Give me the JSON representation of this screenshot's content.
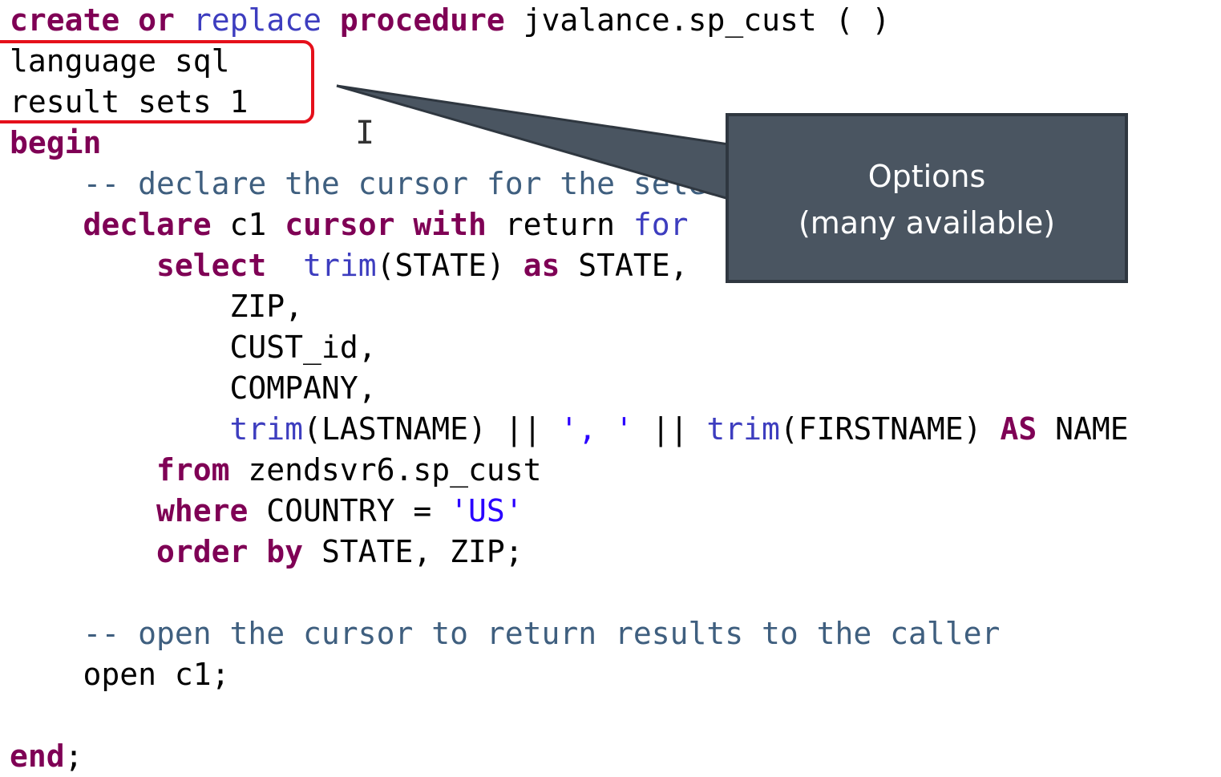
{
  "code": {
    "line1": {
      "kw_create": "create",
      "sp1": " ",
      "kw_or": "or",
      "sp2": " ",
      "fn_replace": "replace",
      "sp3": " ",
      "kw_procedure": "procedure",
      "rest": " jvalance.sp_cust ( )"
    },
    "line2": {
      "text": "language sql"
    },
    "line3": {
      "text": "result sets 1"
    },
    "line4": {
      "kw_begin": "begin"
    },
    "line5": {
      "indent": "    ",
      "comment": "-- declare the cursor for the selec"
    },
    "line6": {
      "indent": "    ",
      "kw_declare": "declare",
      "mid1": " c1 ",
      "kw_cursor": "cursor",
      "sp": " ",
      "kw_with": "with",
      "mid2": " return ",
      "fn_for": "for"
    },
    "line7": {
      "indent": "        ",
      "kw_select": "select",
      "sp": "  ",
      "fn_trim": "trim",
      "mid": "(STATE) ",
      "kw_as": "as",
      "rest": " STATE,"
    },
    "line8": {
      "indent": "            ",
      "text": "ZIP,"
    },
    "line9": {
      "indent": "            ",
      "text": "CUST_id,"
    },
    "line10": {
      "indent": "            ",
      "text": "COMPANY,"
    },
    "line11": {
      "indent": "            ",
      "fn_trim1": "trim",
      "mid1": "(LASTNAME) || ",
      "str": "', '",
      "mid2": " || ",
      "fn_trim2": "trim",
      "mid3": "(FIRSTNAME) ",
      "kw_as": "AS",
      "rest": " NAME"
    },
    "line12": {
      "indent": "        ",
      "kw_from": "from",
      "rest": " zendsvr6.sp_cust"
    },
    "line13": {
      "indent": "        ",
      "kw_where": "where",
      "mid": " COUNTRY = ",
      "str": "'US'"
    },
    "line14": {
      "indent": "        ",
      "kw_order_by": "order by",
      "rest": " STATE, ZIP;"
    },
    "line15": {
      "indent": "    ",
      "comment": "-- open the cursor to return results to the caller"
    },
    "line16": {
      "indent": "    ",
      "text": "open c1;"
    },
    "line17": {
      "kw_end": "end",
      "rest": ";"
    }
  },
  "callout": {
    "line1": "Options",
    "line2": "(many available)"
  },
  "cursor_glyph": "I",
  "colors": {
    "keyword": "#7f0055",
    "function": "#3d3dbf",
    "comment": "#3f5f7f",
    "string": "#2a00ff",
    "highlight_border": "#e5101b",
    "callout_bg": "#4a5561"
  }
}
